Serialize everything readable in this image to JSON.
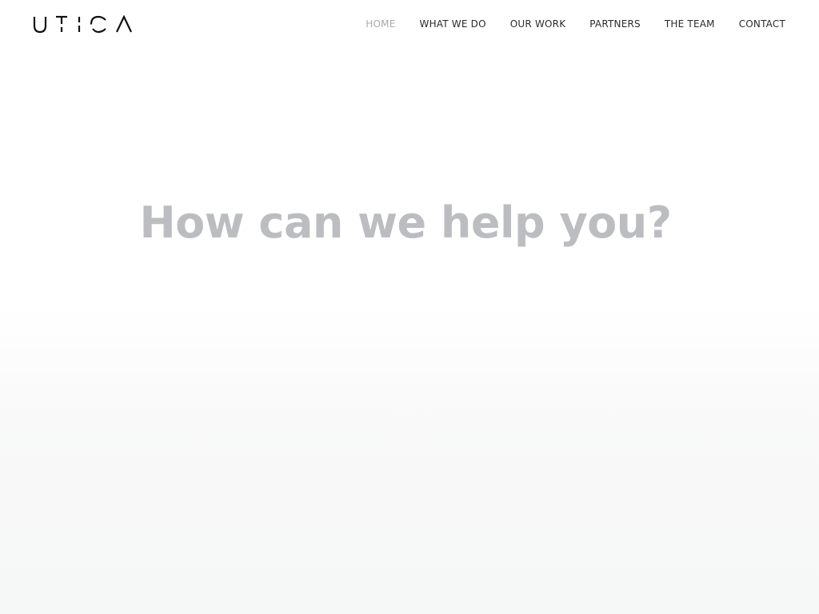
{
  "brand": {
    "logo_text": "UTICA",
    "logo_color": "#111111"
  },
  "nav": {
    "items": [
      {
        "label": "HOME",
        "active": true
      },
      {
        "label": "WHAT WE DO",
        "active": false
      },
      {
        "label": "OUR WORK",
        "active": false
      },
      {
        "label": "PARTNERS",
        "active": false
      },
      {
        "label": "THE TEAM",
        "active": false
      },
      {
        "label": "CONTACT",
        "active": false
      }
    ],
    "active_color": "#a9a9a9",
    "text_color": "#2b2b2b"
  },
  "hero": {
    "title": "How can we help you?",
    "title_color": "#bcbdc0"
  }
}
